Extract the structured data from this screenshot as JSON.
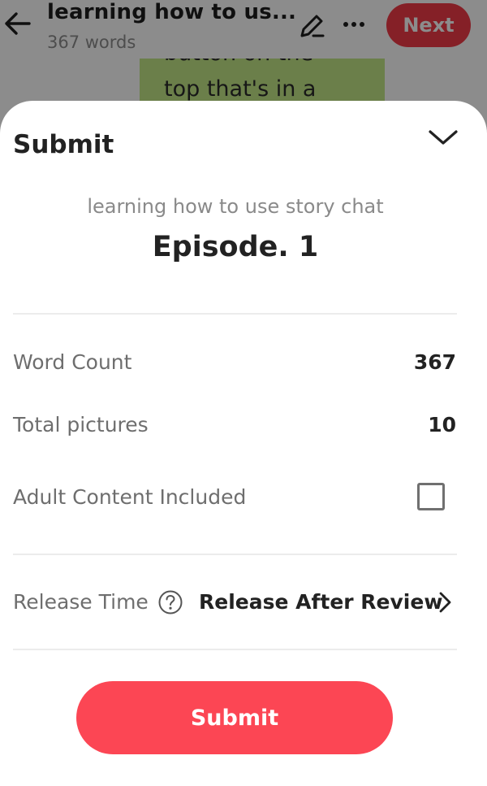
{
  "header": {
    "title": "learning how to us...",
    "word_count": "367 words",
    "next_label": "Next",
    "next_color": "#f23b47"
  },
  "background": {
    "bubble_lines": [
      "button on the",
      "top that's in a"
    ],
    "bubble_color": "#c3e788"
  },
  "sheet": {
    "title": "Submit",
    "story_name": "learning how to use story chat",
    "episode": "Episode. 1",
    "rows": {
      "word_count": {
        "label": "Word Count",
        "value": "367"
      },
      "total_pictures": {
        "label": "Total pictures",
        "value": "10"
      },
      "adult_content": {
        "label": "Adult Content Included",
        "checked": false
      }
    },
    "release": {
      "label": "Release Time",
      "value": "Release After Review"
    },
    "submit_label": "Submit",
    "submit_color": "#fc4654"
  },
  "icons": [
    "back-arrow-icon",
    "pencil-icon",
    "more-icon",
    "chevron-down-icon",
    "help-icon",
    "chevron-right-icon"
  ]
}
